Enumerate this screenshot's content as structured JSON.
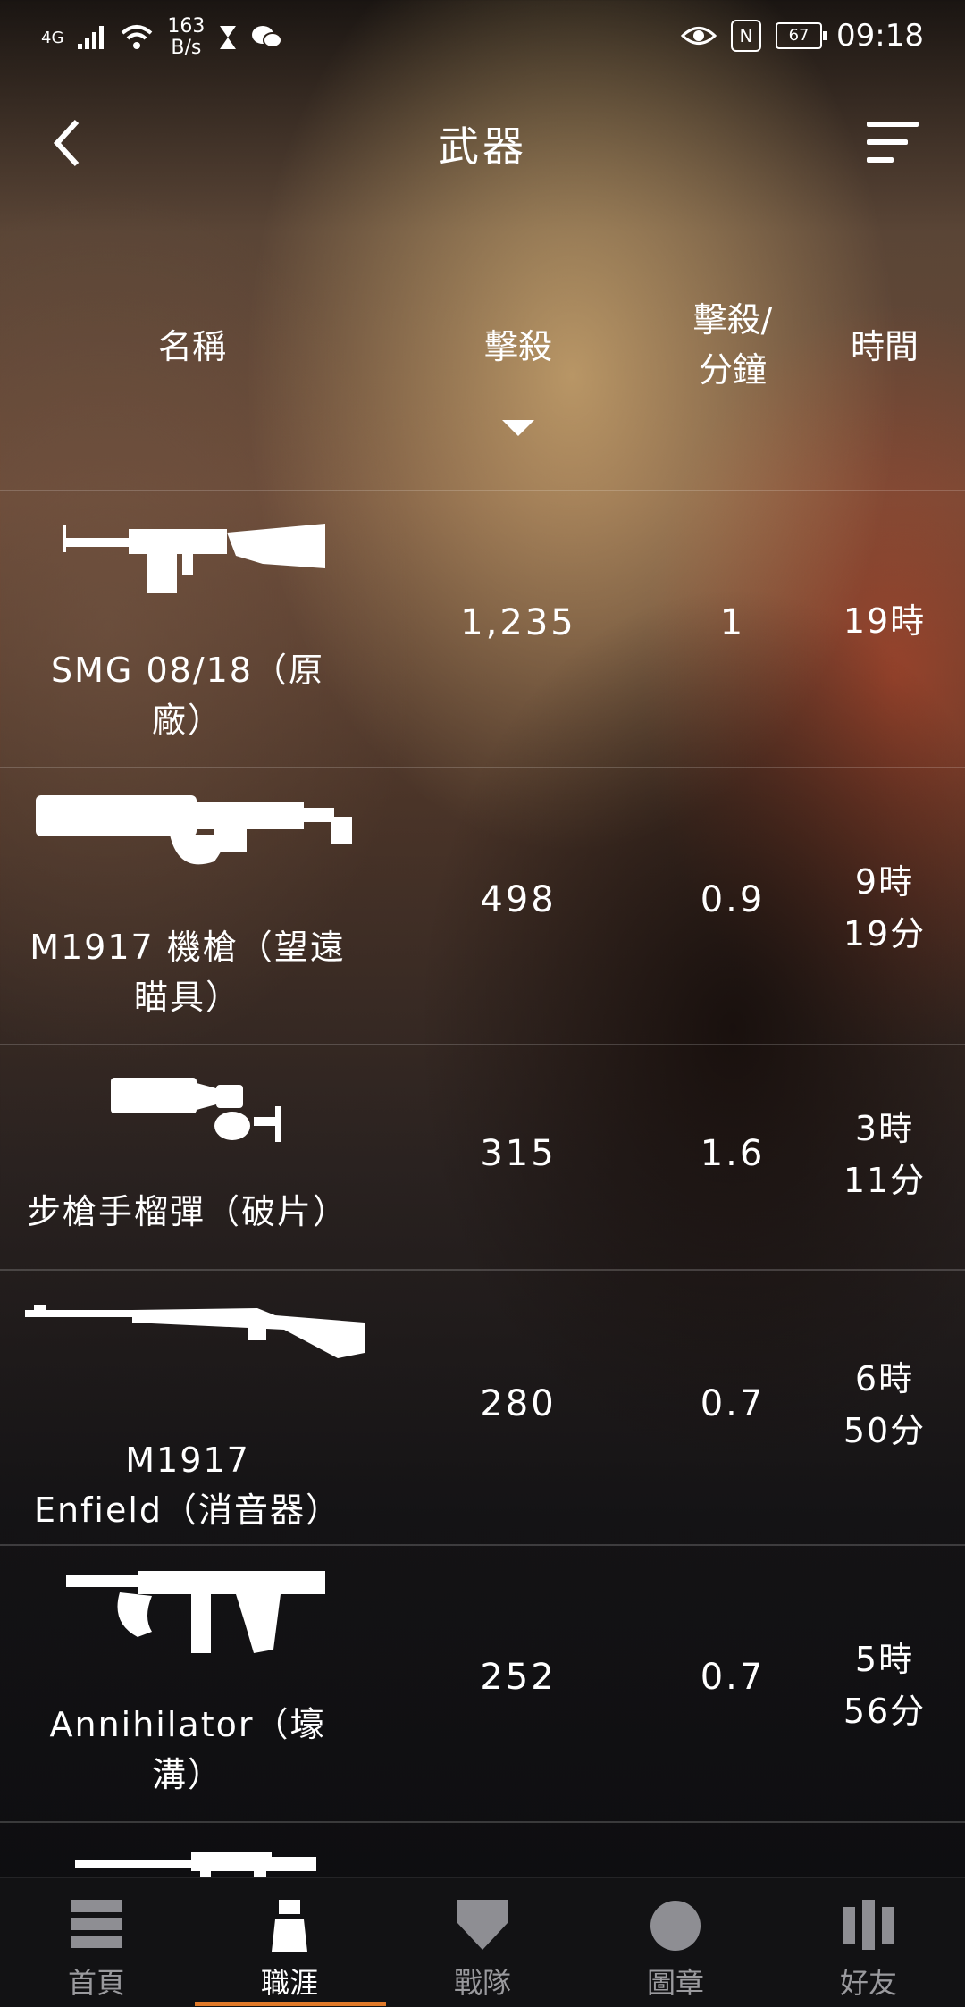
{
  "status_bar": {
    "network": "4G",
    "speed_value": "163",
    "speed_unit": "B/s",
    "battery": "67",
    "time": "09:18"
  },
  "header": {
    "title": "武器"
  },
  "table": {
    "columns": {
      "name": "名稱",
      "kills": "擊殺",
      "kpm_line1": "擊殺/",
      "kpm_line2": "分鐘",
      "time": "時間"
    },
    "rows": [
      {
        "name_line1": "SMG 08/18（原",
        "name_line2": "廠）",
        "kills": "1,235",
        "kpm": "1",
        "time_line1": "19時",
        "time_line2": "",
        "icon": "smg-0818-icon"
      },
      {
        "name_line1": "M1917 機槍（望遠",
        "name_line2": "瞄具）",
        "kills": "498",
        "kpm": "0.9",
        "time_line1": "9時",
        "time_line2": "19分",
        "icon": "m1917-mg-icon"
      },
      {
        "name_line1": "步槍手榴彈（破片）",
        "name_line2": "",
        "kills": "315",
        "kpm": "1.6",
        "time_line1": "3時",
        "time_line2": "11分",
        "icon": "rifle-grenade-icon"
      },
      {
        "name_line1": "M1917",
        "name_line2": "Enfield（消音器）",
        "kills": "280",
        "kpm": "0.7",
        "time_line1": "6時",
        "time_line2": "50分",
        "icon": "m1917-enfield-icon"
      },
      {
        "name_line1": "Annihilator（壕",
        "name_line2": "溝）",
        "kills": "252",
        "kpm": "0.7",
        "time_line1": "5時",
        "time_line2": "56分",
        "icon": "annihilator-icon"
      }
    ]
  },
  "nav": {
    "items": [
      {
        "label": "首頁",
        "icon": "home-icon"
      },
      {
        "label": "職涯",
        "icon": "career-icon"
      },
      {
        "label": "戰隊",
        "icon": "platoon-icon"
      },
      {
        "label": "圖章",
        "icon": "emblem-icon"
      },
      {
        "label": "好友",
        "icon": "friends-icon"
      }
    ],
    "active_index": 1,
    "accent_color": "#e07a2a"
  }
}
